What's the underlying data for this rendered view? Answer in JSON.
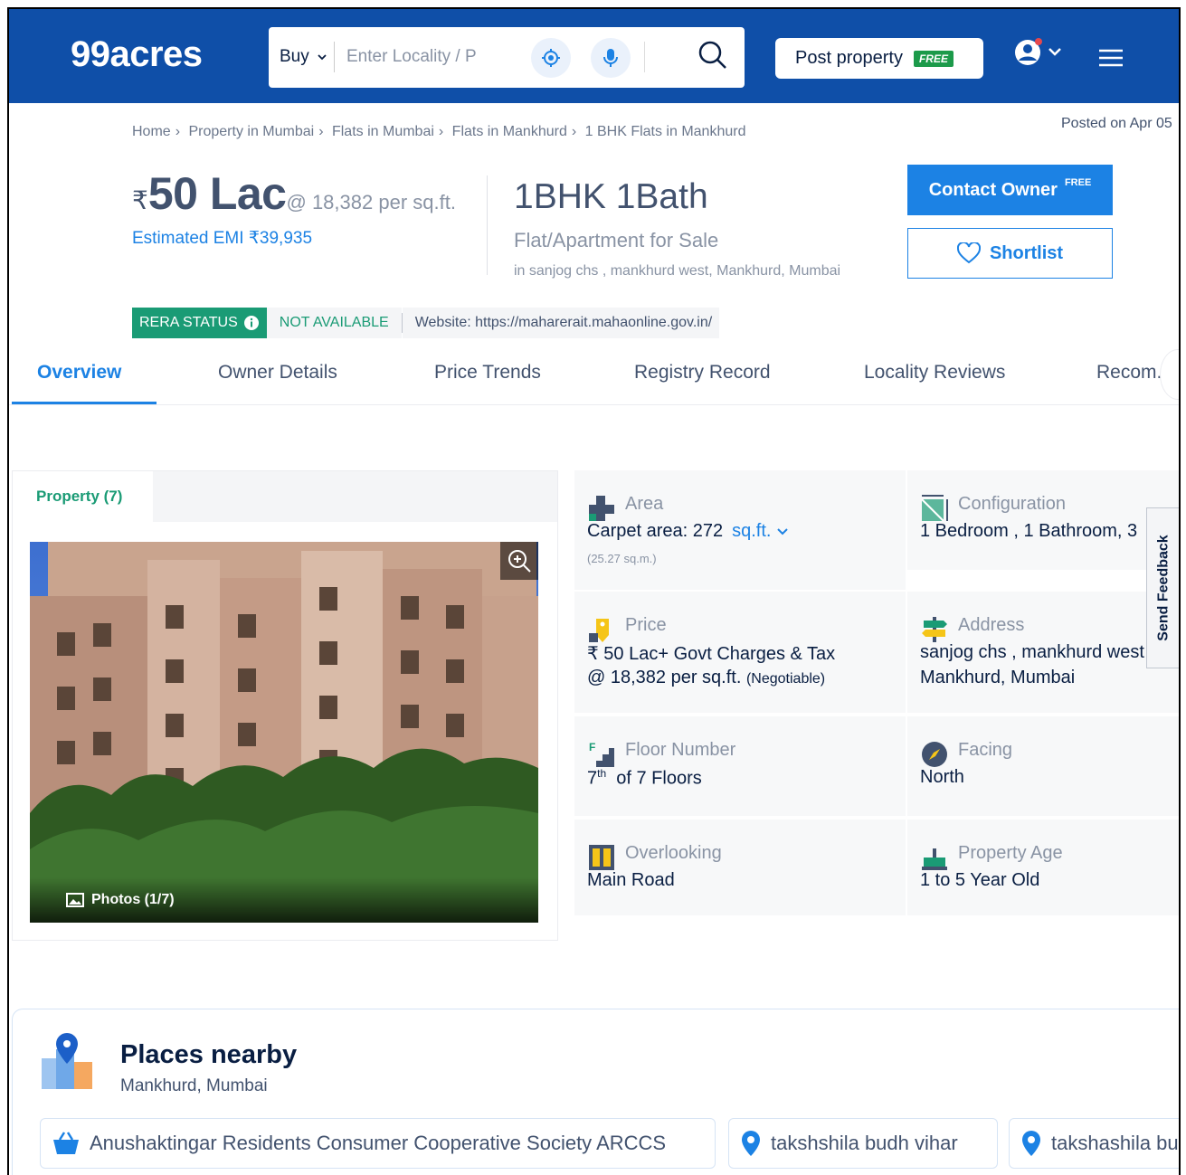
{
  "header": {
    "logo": "99acres",
    "buy_label": "Buy",
    "search_placeholder": "Enter Locality / P",
    "post_property_label": "Post property",
    "post_property_badge": "FREE",
    "brand_color": "#0F4FA8"
  },
  "breadcrumb": {
    "items": [
      "Home",
      "Property in Mumbai",
      "Flats in Mumbai",
      "Flats in Mankhurd",
      "1 BHK Flats in Mankhurd"
    ],
    "separator": "›"
  },
  "posted": "Posted on Apr 05",
  "listing": {
    "currency": "₹",
    "price": "50 Lac",
    "per_sqft": "@ 18,382 per sq.ft.",
    "emi": "Estimated EMI ₹39,935",
    "config_title": "1BHK 1Bath",
    "config_sub": "Flat/Apartment for Sale",
    "config_addr": "in sanjog chs , mankhurd west, Mankhurd, Mumbai"
  },
  "actions": {
    "contact_label": "Contact Owner",
    "contact_badge": "FREE",
    "shortlist_label": "Shortlist"
  },
  "rera": {
    "status_label": "RERA STATUS",
    "availability": "NOT AVAILABLE",
    "website": "Website: https://maharerait.mahaonline.gov.in/"
  },
  "tabs": [
    "Overview",
    "Owner Details",
    "Price Trends",
    "Registry Record",
    "Locality Reviews",
    "Recom..."
  ],
  "photos": {
    "tab_label": "Property (7)",
    "count_label": "Photos (1/7)"
  },
  "details": {
    "area": {
      "label": "Area",
      "value": "Carpet area: 272",
      "unit": "sq.ft.",
      "sub": "(25.27 sq.m.)"
    },
    "configuration": {
      "label": "Configuration",
      "value": "1 Bedroom , 1 Bathroom, 3"
    },
    "price": {
      "label": "Price",
      "value": "₹ 50 Lac+ Govt Charges & Tax",
      "value2": "@ 18,382 per sq.ft.",
      "negotiable": "(Negotiable)"
    },
    "address": {
      "label": "Address",
      "value": "sanjog chs , mankhurd west",
      "value2": "Mankhurd, Mumbai"
    },
    "floor": {
      "label": "Floor Number",
      "value_num": "7",
      "value_sup": "th",
      "value_rest": "of 7 Floors"
    },
    "facing": {
      "label": "Facing",
      "value": "North"
    },
    "overlooking": {
      "label": "Overlooking",
      "value": "Main Road"
    },
    "age": {
      "label": "Property Age",
      "value": "1 to 5 Year Old"
    }
  },
  "feedback_label": "Send Feedback",
  "places": {
    "title": "Places nearby",
    "subtitle": "Mankhurd, Mumbai",
    "chips": [
      "Anushaktingar Residents Consumer Cooperative Society ARCCS",
      "takshshila budh vihar",
      "takshashila bu"
    ]
  }
}
